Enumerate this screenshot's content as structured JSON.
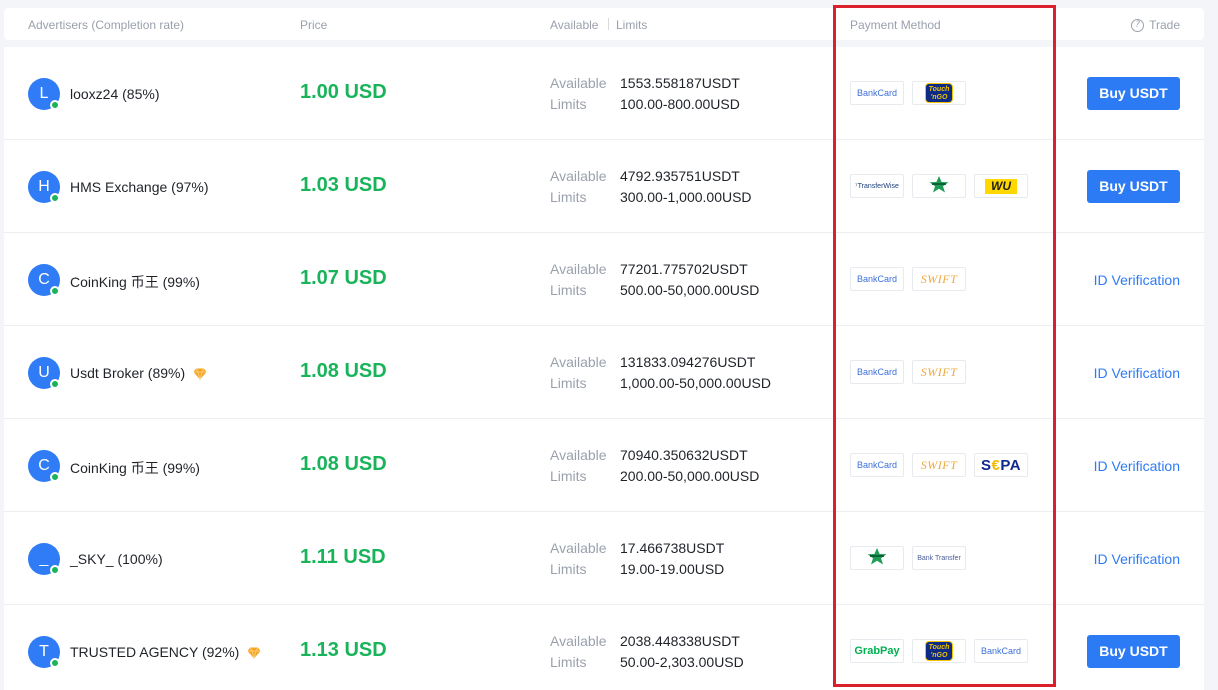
{
  "header": {
    "advertisers": "Advertisers (Completion rate)",
    "price": "Price",
    "available": "Available",
    "limits": "Limits",
    "payment_method": "Payment Method",
    "trade": "Trade",
    "trade_icon": "question-circle-icon"
  },
  "labels": {
    "available": "Available",
    "limits": "Limits"
  },
  "colors": {
    "accent": "#2d7bf4",
    "price": "#19b35a",
    "online": "#19b35a",
    "highlight": "#d9202c"
  },
  "offers": [
    {
      "initial": "L",
      "advertiser": "looxz24 (85%)",
      "badge": false,
      "price": "1.00 USD",
      "available": "1553.558187USDT",
      "limits": "100.00-800.00USD",
      "payments": [
        {
          "type": "bankcard",
          "label": "BankCard"
        },
        {
          "type": "touchngo",
          "label": "Touch n GO"
        }
      ],
      "action": {
        "type": "buy",
        "label": "Buy USDT"
      }
    },
    {
      "initial": "H",
      "advertiser": "HMS Exchange (97%)",
      "badge": false,
      "price": "1.03 USD",
      "available": "4792.935751USDT",
      "limits": "300.00-1,000.00USD",
      "payments": [
        {
          "type": "transferwise",
          "label": "TransferWise"
        },
        {
          "type": "star",
          "label": ""
        },
        {
          "type": "wu",
          "label": "WU"
        }
      ],
      "action": {
        "type": "buy",
        "label": "Buy USDT"
      }
    },
    {
      "initial": "C",
      "advertiser": "CoinKing 币王 (99%)",
      "badge": false,
      "price": "1.07 USD",
      "available": "77201.775702USDT",
      "limits": "500.00-50,000.00USD",
      "payments": [
        {
          "type": "bankcard",
          "label": "BankCard"
        },
        {
          "type": "swift",
          "label": "SWIFT"
        }
      ],
      "action": {
        "type": "verify",
        "label": "ID Verification"
      }
    },
    {
      "initial": "U",
      "advertiser": "Usdt Broker (89%)",
      "badge": true,
      "price": "1.08 USD",
      "available": "131833.094276USDT",
      "limits": "1,000.00-50,000.00USD",
      "payments": [
        {
          "type": "bankcard",
          "label": "BankCard"
        },
        {
          "type": "swift",
          "label": "SWIFT"
        }
      ],
      "action": {
        "type": "verify",
        "label": "ID Verification"
      }
    },
    {
      "initial": "C",
      "advertiser": "CoinKing 币王 (99%)",
      "badge": false,
      "price": "1.08 USD",
      "available": "70940.350632USDT",
      "limits": "200.00-50,000.00USD",
      "payments": [
        {
          "type": "bankcard",
          "label": "BankCard"
        },
        {
          "type": "swift",
          "label": "SWIFT"
        },
        {
          "type": "sepa",
          "label": "SEPA"
        }
      ],
      "action": {
        "type": "verify",
        "label": "ID Verification"
      }
    },
    {
      "initial": "_",
      "advertiser": "_SKY_ (100%)",
      "badge": false,
      "price": "1.11 USD",
      "available": "17.466738USDT",
      "limits": "19.00-19.00USD",
      "payments": [
        {
          "type": "star",
          "label": ""
        },
        {
          "type": "banktransfer",
          "label": "Bank Transfer"
        }
      ],
      "action": {
        "type": "verify",
        "label": "ID Verification"
      }
    },
    {
      "initial": "T",
      "advertiser": "TRUSTED AGENCY (92%)",
      "badge": true,
      "price": "1.13 USD",
      "available": "2038.448338USDT",
      "limits": "50.00-2,303.00USD",
      "payments": [
        {
          "type": "grabpay",
          "label": "GrabPay"
        },
        {
          "type": "touchngo",
          "label": "Touch n GO"
        },
        {
          "type": "bankcard",
          "label": "BankCard"
        }
      ],
      "action": {
        "type": "buy",
        "label": "Buy USDT"
      }
    }
  ]
}
